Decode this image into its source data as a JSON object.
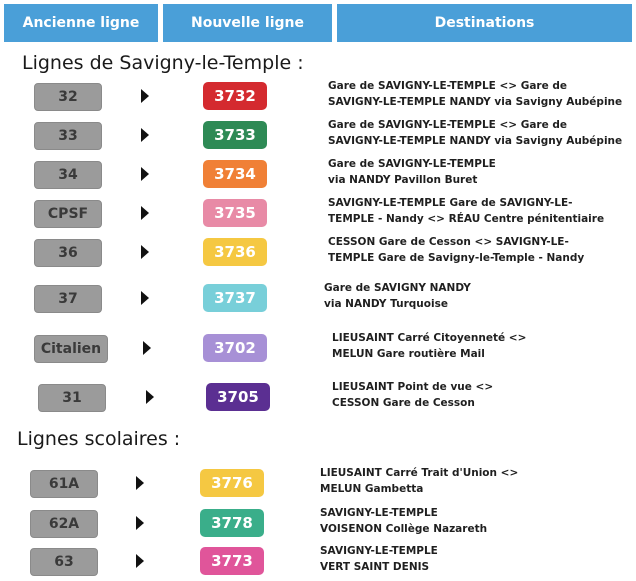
{
  "header": {
    "col_old": "Ancienne ligne",
    "col_new": "Nouvelle ligne",
    "col_dest": "Destinations"
  },
  "sections": {
    "savigny": "Lignes de Savigny-le-Temple :",
    "scolaires": "Lignes scolaires :"
  },
  "rows": [
    {
      "old": "32",
      "new": "3732",
      "color": "#d42a2f",
      "dest1": "Gare de SAVIGNY-LE-TEMPLE <> Gare de",
      "dest2": "SAVIGNY-LE-TEMPLE NANDY via Savigny Aubépine"
    },
    {
      "old": "33",
      "new": "3733",
      "color": "#2e8a55",
      "dest1": "Gare de SAVIGNY-LE-TEMPLE <> Gare de",
      "dest2": "SAVIGNY-LE-TEMPLE NANDY via Savigny Aubépine"
    },
    {
      "old": "34",
      "new": "3734",
      "color": "#f08036",
      "dest1": "Gare de SAVIGNY-LE-TEMPLE",
      "dest2": "via NANDY Pavillon Buret"
    },
    {
      "old": "CPSF",
      "new": "3735",
      "color": "#e88aa6",
      "dest1": "SAVIGNY-LE-TEMPLE Gare de SAVIGNY-LE-",
      "dest2": "TEMPLE - Nandy <> RÉAU Centre pénitentiaire"
    },
    {
      "old": "36",
      "new": "3736",
      "color": "#f5c842",
      "dest1": "CESSON Gare de Cesson <> SAVIGNY-LE-",
      "dest2": "TEMPLE Gare de Savigny-le-Temple - Nandy"
    },
    {
      "old": "37",
      "new": "3737",
      "color": "#78cfd9",
      "dest1": "Gare de SAVIGNY NANDY",
      "dest2": "via NANDY Turquoise"
    },
    {
      "old": "Citalien",
      "new": "3702",
      "color": "#a790d6",
      "dest1": "LIEUSAINT Carré Citoyenneté <>",
      "dest2": "MELUN Gare routière Mail"
    },
    {
      "old": "31",
      "new": "3705",
      "color": "#5b2f92",
      "dest1": "LIEUSAINT Point de vue <>",
      "dest2": "CESSON Gare de Cesson"
    },
    {
      "old": "61A",
      "new": "3776",
      "color": "#f5c842",
      "dest1": "LIEUSAINT Carré Trait d'Union <>",
      "dest2": "MELUN Gambetta"
    },
    {
      "old": "62A",
      "new": "3778",
      "color": "#3aae8a",
      "dest1": "SAVIGNY-LE-TEMPLE",
      "dest2": "VOISENON Collège Nazareth"
    },
    {
      "old": "63",
      "new": "3773",
      "color": "#e0559a",
      "dest1": "SAVIGNY-LE-TEMPLE",
      "dest2": "VERT SAINT DENIS"
    }
  ]
}
